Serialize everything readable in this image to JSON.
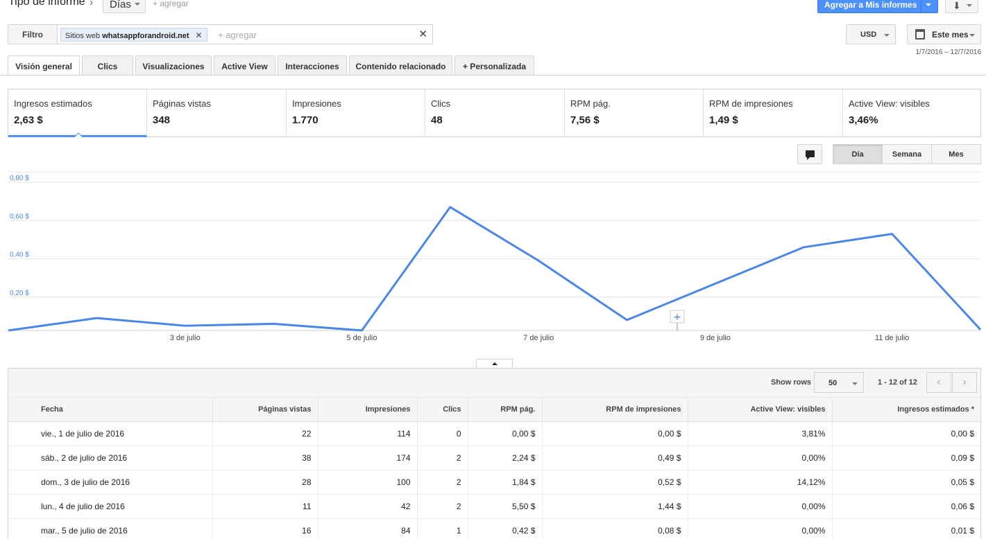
{
  "header": {
    "report_type_label": "Tipo de informe",
    "granularity_value": "Días",
    "add_link": "+ agregar",
    "add_to_reports_label": "Agregar a Mis informes"
  },
  "filter": {
    "label": "Filtro",
    "chip_prefix": "Sitios web",
    "chip_value": "whatsappforandroid.net",
    "add_placeholder": "+ agregar"
  },
  "currency": "USD",
  "date_range_button": "Este mes",
  "date_range_text": "1/7/2016 – 12/7/2016",
  "tabs": [
    "Visión general",
    "Clics",
    "Visualizaciones",
    "Active View",
    "Interacciones",
    "Contenido relacionado",
    "+ Personalizada"
  ],
  "metrics": [
    {
      "label": "Ingresos estimados",
      "value": "2,63 $"
    },
    {
      "label": "Páginas vistas",
      "value": "348"
    },
    {
      "label": "Impresiones",
      "value": "1.770"
    },
    {
      "label": "Clics",
      "value": "48"
    },
    {
      "label": "RPM pág.",
      "value": "7,56 $"
    },
    {
      "label": "RPM de impresiones",
      "value": "1,49 $"
    },
    {
      "label": "Active View: visibles",
      "value": "3,46%"
    }
  ],
  "period_buttons": [
    "Día",
    "Semana",
    "Mes"
  ],
  "colors": {
    "accent": "#4d90fe",
    "line": "#4a86e8",
    "ytick": "#4a86e8"
  },
  "chart_data": {
    "type": "line",
    "x": [
      "1 de julio",
      "2 de julio",
      "3 de julio",
      "4 de julio",
      "5 de julio",
      "6 de julio",
      "7 de julio",
      "8 de julio",
      "9 de julio",
      "10 de julio",
      "11 de julio",
      "12 de julio"
    ],
    "x_tick_labels": [
      "3 de julio",
      "5 de julio",
      "7 de julio",
      "9 de julio",
      "11 de julio"
    ],
    "y_tick_labels": [
      "0,20 $",
      "0,40 $",
      "0,60 $",
      "0,80 $"
    ],
    "y_ticks": [
      0.2,
      0.4,
      0.6,
      0.8
    ],
    "ylim": [
      0,
      0.8
    ],
    "series": [
      {
        "values": [
          0.0,
          0.09,
          0.05,
          0.06,
          0.01,
          0.67,
          0.39,
          0.08,
          0.27,
          0.46,
          0.53,
          0.03
        ]
      }
    ],
    "grid": true
  },
  "table": {
    "show_rows_label": "Show rows",
    "rows_value": "50",
    "pager_text": "1 - 12 of 12",
    "columns": [
      "Fecha",
      "Páginas vistas",
      "Impresiones",
      "Clics",
      "RPM pág.",
      "RPM de impresiones",
      "Active View: visibles",
      "Ingresos estimados *"
    ],
    "rows": [
      [
        "vie., 1 de julio de 2016",
        "22",
        "114",
        "0",
        "0,00 $",
        "0,00 $",
        "3,81%",
        "0,00 $"
      ],
      [
        "sáb., 2 de julio de 2016",
        "38",
        "174",
        "2",
        "2,24 $",
        "0,49 $",
        "0,00%",
        "0,09 $"
      ],
      [
        "dom., 3 de julio de 2016",
        "28",
        "100",
        "2",
        "1,84 $",
        "0,52 $",
        "14,12%",
        "0,05 $"
      ],
      [
        "lun., 4 de julio de 2016",
        "11",
        "42",
        "2",
        "5,50 $",
        "1,44 $",
        "0,00%",
        "0,06 $"
      ],
      [
        "mar., 5 de julio de 2016",
        "16",
        "84",
        "1",
        "0,42 $",
        "0,08 $",
        "0,00%",
        "0,01 $"
      ]
    ]
  }
}
